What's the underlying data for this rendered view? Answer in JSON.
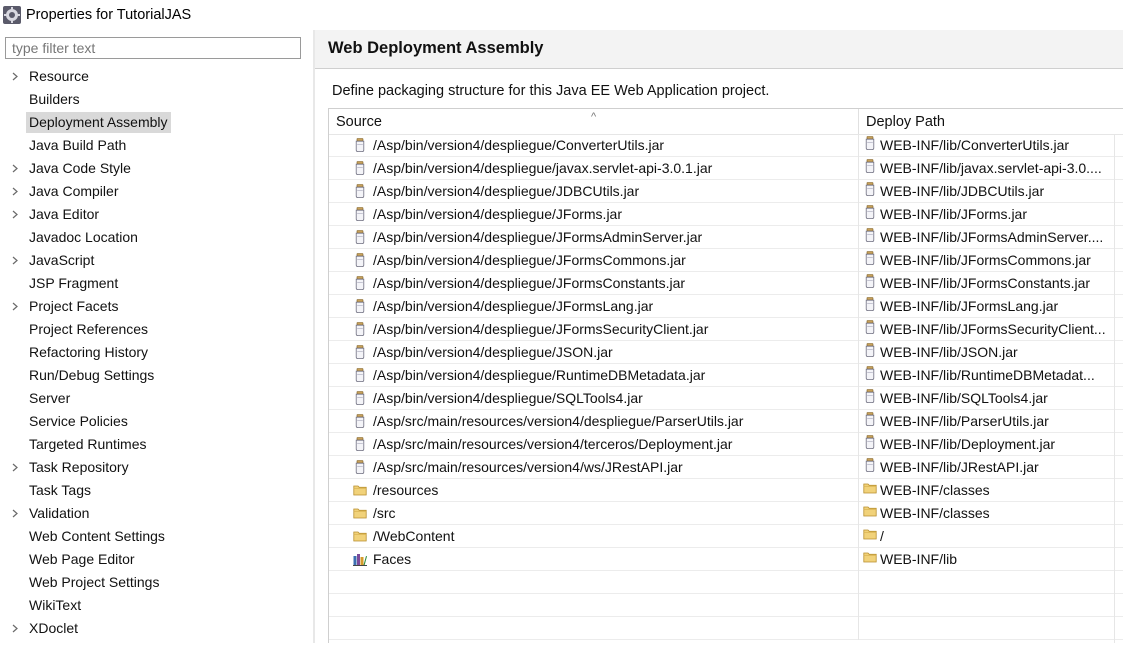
{
  "window": {
    "title": "Properties for TutorialJAS"
  },
  "filter": {
    "placeholder": "type filter text"
  },
  "tree": [
    {
      "label": "Resource",
      "expandable": true
    },
    {
      "label": "Builders",
      "expandable": false
    },
    {
      "label": "Deployment Assembly",
      "expandable": false,
      "selected": true
    },
    {
      "label": "Java Build Path",
      "expandable": false
    },
    {
      "label": "Java Code Style",
      "expandable": true
    },
    {
      "label": "Java Compiler",
      "expandable": true
    },
    {
      "label": "Java Editor",
      "expandable": true
    },
    {
      "label": "Javadoc Location",
      "expandable": false
    },
    {
      "label": "JavaScript",
      "expandable": true
    },
    {
      "label": "JSP Fragment",
      "expandable": false
    },
    {
      "label": "Project Facets",
      "expandable": true
    },
    {
      "label": "Project References",
      "expandable": false
    },
    {
      "label": "Refactoring History",
      "expandable": false
    },
    {
      "label": "Run/Debug Settings",
      "expandable": false
    },
    {
      "label": "Server",
      "expandable": false
    },
    {
      "label": "Service Policies",
      "expandable": false
    },
    {
      "label": "Targeted Runtimes",
      "expandable": false
    },
    {
      "label": "Task Repository",
      "expandable": true
    },
    {
      "label": "Task Tags",
      "expandable": false
    },
    {
      "label": "Validation",
      "expandable": true
    },
    {
      "label": "Web Content Settings",
      "expandable": false
    },
    {
      "label": "Web Page Editor",
      "expandable": false
    },
    {
      "label": "Web Project Settings",
      "expandable": false
    },
    {
      "label": "WikiText",
      "expandable": false
    },
    {
      "label": "XDoclet",
      "expandable": true
    }
  ],
  "page": {
    "title": "Web Deployment Assembly",
    "description": "Define packaging structure for this Java EE Web Application project."
  },
  "table": {
    "columns": {
      "source": "Source",
      "deploy": "Deploy Path"
    },
    "rows": [
      {
        "source": "/Asp/bin/version4/despliegue/ConverterUtils.jar",
        "deploy": "WEB-INF/lib/ConverterUtils.jar",
        "icon": "jar-icon"
      },
      {
        "source": "/Asp/bin/version4/despliegue/javax.servlet-api-3.0.1.jar",
        "deploy": "WEB-INF/lib/javax.servlet-api-3.0....",
        "icon": "jar-icon"
      },
      {
        "source": "/Asp/bin/version4/despliegue/JDBCUtils.jar",
        "deploy": "WEB-INF/lib/JDBCUtils.jar",
        "icon": "jar-icon"
      },
      {
        "source": "/Asp/bin/version4/despliegue/JForms.jar",
        "deploy": "WEB-INF/lib/JForms.jar",
        "icon": "jar-icon"
      },
      {
        "source": "/Asp/bin/version4/despliegue/JFormsAdminServer.jar",
        "deploy": "WEB-INF/lib/JFormsAdminServer....",
        "icon": "jar-icon"
      },
      {
        "source": "/Asp/bin/version4/despliegue/JFormsCommons.jar",
        "deploy": "WEB-INF/lib/JFormsCommons.jar",
        "icon": "jar-icon"
      },
      {
        "source": "/Asp/bin/version4/despliegue/JFormsConstants.jar",
        "deploy": "WEB-INF/lib/JFormsConstants.jar",
        "icon": "jar-icon"
      },
      {
        "source": "/Asp/bin/version4/despliegue/JFormsLang.jar",
        "deploy": "WEB-INF/lib/JFormsLang.jar",
        "icon": "jar-icon"
      },
      {
        "source": "/Asp/bin/version4/despliegue/JFormsSecurityClient.jar",
        "deploy": "WEB-INF/lib/JFormsSecurityClient...",
        "icon": "jar-icon"
      },
      {
        "source": "/Asp/bin/version4/despliegue/JSON.jar",
        "deploy": "WEB-INF/lib/JSON.jar",
        "icon": "jar-icon"
      },
      {
        "source": "/Asp/bin/version4/despliegue/RuntimeDBMetadata.jar",
        "deploy": "WEB-INF/lib/RuntimeDBMetadat...",
        "icon": "jar-icon"
      },
      {
        "source": "/Asp/bin/version4/despliegue/SQLTools4.jar",
        "deploy": "WEB-INF/lib/SQLTools4.jar",
        "icon": "jar-icon"
      },
      {
        "source": "/Asp/src/main/resources/version4/despliegue/ParserUtils.jar",
        "deploy": "WEB-INF/lib/ParserUtils.jar",
        "icon": "jar-icon"
      },
      {
        "source": "/Asp/src/main/resources/version4/terceros/Deployment.jar",
        "deploy": "WEB-INF/lib/Deployment.jar",
        "icon": "jar-icon"
      },
      {
        "source": "/Asp/src/main/resources/version4/ws/JRestAPI.jar",
        "deploy": "WEB-INF/lib/JRestAPI.jar",
        "icon": "jar-icon"
      },
      {
        "source": "/resources",
        "deploy": "WEB-INF/classes",
        "icon": "folder-icon"
      },
      {
        "source": "/src",
        "deploy": "WEB-INF/classes",
        "icon": "folder-icon"
      },
      {
        "source": "/WebContent",
        "deploy": "/",
        "icon": "folder-icon"
      },
      {
        "source": "Faces",
        "deploy": "WEB-INF/lib",
        "icon": "library-icon"
      }
    ]
  }
}
